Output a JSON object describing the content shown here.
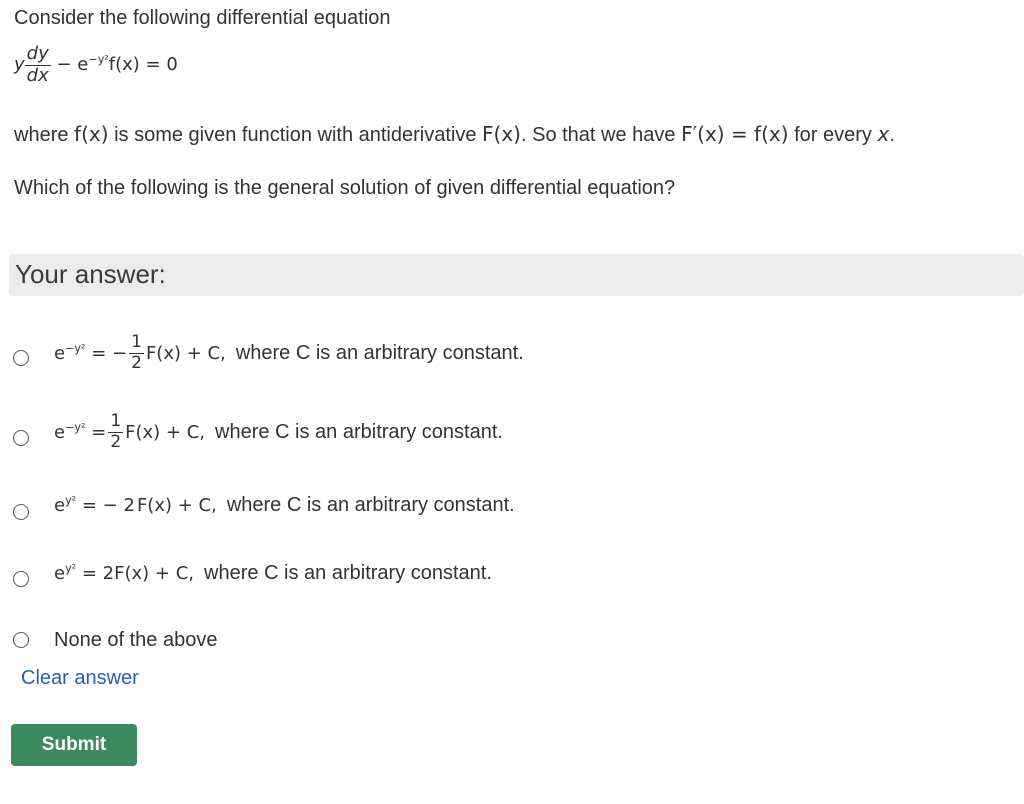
{
  "question": {
    "intro": "Consider the following differential equation",
    "equation": {
      "y": "y",
      "num": "dy",
      "den": "dx",
      "minus_e": "− e",
      "exp": "−y²",
      "rest": "f(x) = 0"
    },
    "where_parts": {
      "p1": "where ",
      "fx": "f(x)",
      "p2": " is some given function with antiderivative ",
      "Fx": "F(x)",
      "p3": ". So that we have ",
      "deriv": "F′(x) = f(x)",
      "p4": " for every ",
      "x": "x",
      "p5": "."
    },
    "prompt": "Which of the following is the general solution of given differential equation?"
  },
  "answer_header": "Your answer:",
  "options": [
    {
      "lhs_base": "e",
      "lhs_exp": "−y²",
      "eq": " = −",
      "frac_num": "1",
      "frac_den": "2",
      "rhs": "F(x) + C,",
      "text": "where C is an arbitrary constant."
    },
    {
      "lhs_base": "e",
      "lhs_exp": "−y²",
      "eq": " = ",
      "frac_num": "1",
      "frac_den": "2",
      "rhs": "F(x) + C,",
      "text": "where C is an arbitrary constant."
    },
    {
      "lhs_base": "e",
      "lhs_exp": "y²",
      "eq": " = − 2",
      "rhs": "F(x) + C,",
      "text": "where C is an arbitrary constant."
    },
    {
      "lhs_base": "e",
      "lhs_exp": "y²",
      "eq": " = 2",
      "rhs": "F(x) + C,",
      "text": "where C is an arbitrary constant."
    },
    {
      "text": "None of the above"
    }
  ],
  "clear_answer": "Clear answer",
  "submit_label": "Submit"
}
